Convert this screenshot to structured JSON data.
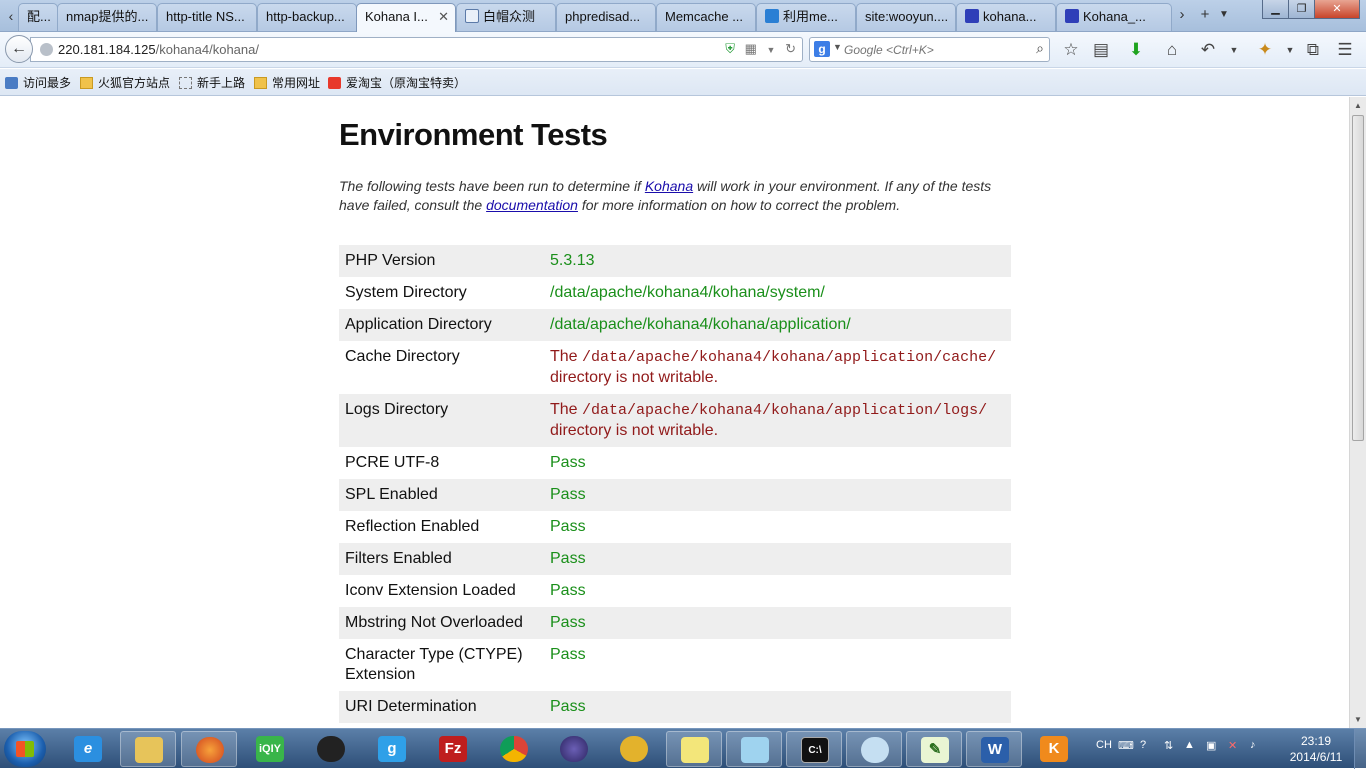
{
  "browser": {
    "tabs": [
      {
        "label": "配...",
        "active": false
      },
      {
        "label": "nmap提供的...",
        "active": false
      },
      {
        "label": "http-title NS...",
        "active": false
      },
      {
        "label": "http-backup...",
        "active": false
      },
      {
        "label": "Kohana I...",
        "active": true
      },
      {
        "label": "白帽众测",
        "active": false
      },
      {
        "label": "phpredisad...",
        "active": false
      },
      {
        "label": "Memcache ...",
        "active": false
      },
      {
        "label": "利用me...",
        "active": false
      },
      {
        "label": "site:wooyun....",
        "active": false
      },
      {
        "label": "kohana...",
        "active": false
      },
      {
        "label": "Kohana_...",
        "active": false
      }
    ],
    "url_host": "220.181.184.125",
    "url_path": "/kohana4/kohana/",
    "search_placeholder": "Google <Ctrl+K>",
    "bookmarks": [
      "访问最多",
      "火狐官方站点",
      "新手上路",
      "常用网址",
      "爱淘宝（原淘宝特卖）"
    ]
  },
  "page": {
    "title": "Environment Tests",
    "intro_before_kohana": "The following tests have been run to determine if ",
    "kohana_link": "Kohana",
    "intro_middle": " will work in your environment. If any of the tests have failed, consult the ",
    "documentation_link": "documentation",
    "intro_after": " for more information on how to correct the problem.",
    "tests": [
      {
        "label": "PHP Version",
        "result": "5.3.13"
      },
      {
        "label": "System Directory",
        "result": "/data/apache/kohana4/kohana/system/"
      },
      {
        "label": "Application Directory",
        "result": "/data/apache/kohana4/kohana/application/"
      },
      {
        "label": "Cache Directory",
        "fail_prefix": "The ",
        "fail_path": "/data/apache/kohana4/kohana/application/cache/",
        "fail_suffix": " directory is not writable."
      },
      {
        "label": "Logs Directory",
        "fail_prefix": "The ",
        "fail_path": "/data/apache/kohana4/kohana/application/logs/",
        "fail_suffix": " directory is not writable."
      },
      {
        "label": "PCRE UTF-8",
        "result": "Pass"
      },
      {
        "label": "SPL Enabled",
        "result": "Pass"
      },
      {
        "label": "Reflection Enabled",
        "result": "Pass"
      },
      {
        "label": "Filters Enabled",
        "result": "Pass"
      },
      {
        "label": "Iconv Extension Loaded",
        "result": "Pass"
      },
      {
        "label": "Mbstring Not Overloaded",
        "result": "Pass"
      },
      {
        "label": "Character Type (CTYPE) Extension",
        "result": "Pass"
      },
      {
        "label": "URI Determination",
        "result": "Pass"
      }
    ]
  },
  "taskbar": {
    "tray_lang": "CH",
    "time": "23:19",
    "date": "2014/6/11"
  },
  "colors": {
    "pass": "#1a8f1a",
    "fail": "#911a1a",
    "row_alt": "#eeeeee"
  }
}
